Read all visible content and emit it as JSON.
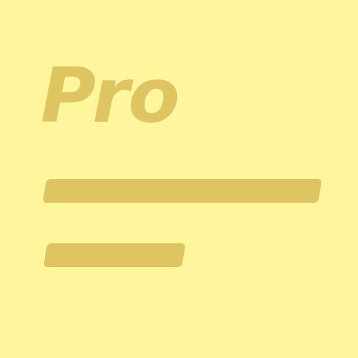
{
  "icon": {
    "label": "Pro",
    "background_color": "#FFF59D",
    "foreground_color": "#DEC562",
    "lines": [
      "long-line",
      "short-line"
    ]
  }
}
